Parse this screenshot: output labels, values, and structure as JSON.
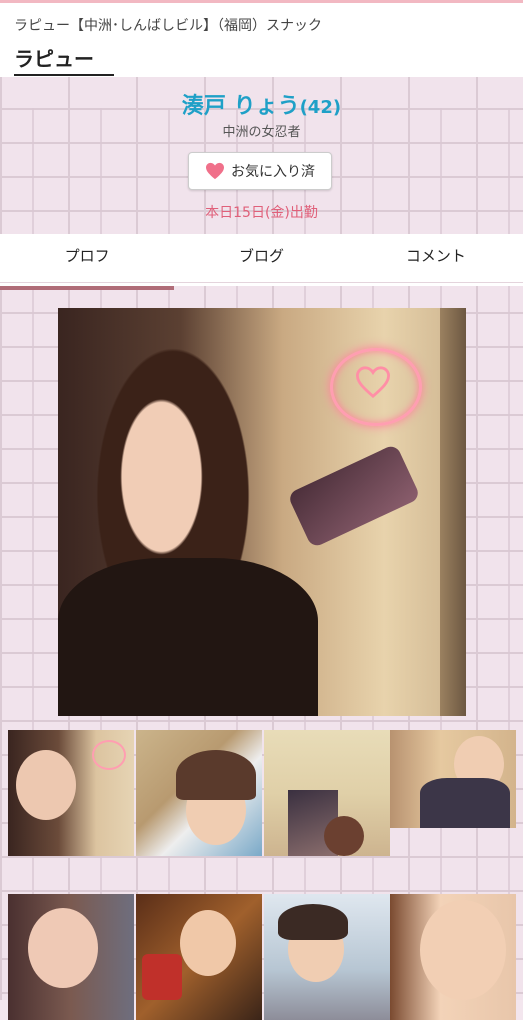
{
  "header": {
    "breadcrumb": "ラピュー【中洲･しんばしビル】（福岡）スナック",
    "shop_title": "ラピュー"
  },
  "profile": {
    "name": "湊戸 りょう",
    "age": "(42)",
    "catchphrase": "中洲の女忍者",
    "favorite_label": "お気に入り済",
    "shift": "本日15日(金)出勤"
  },
  "tabs": [
    {
      "label": "プロフ",
      "active": true
    },
    {
      "label": "ブログ",
      "active": false
    },
    {
      "label": "コメント",
      "active": false
    }
  ],
  "gallery": {
    "main_photo": "selfie-heart-neon",
    "thumbnails": [
      "thumb-1",
      "thumb-2",
      "thumb-3",
      "thumb-4",
      "thumb-5",
      "thumb-6",
      "thumb-7",
      "thumb-8"
    ]
  },
  "colors": {
    "name": "#1fa0c7",
    "shift": "#e0607a",
    "tab_underline": "#b06c78",
    "heart": "#f0708a"
  }
}
